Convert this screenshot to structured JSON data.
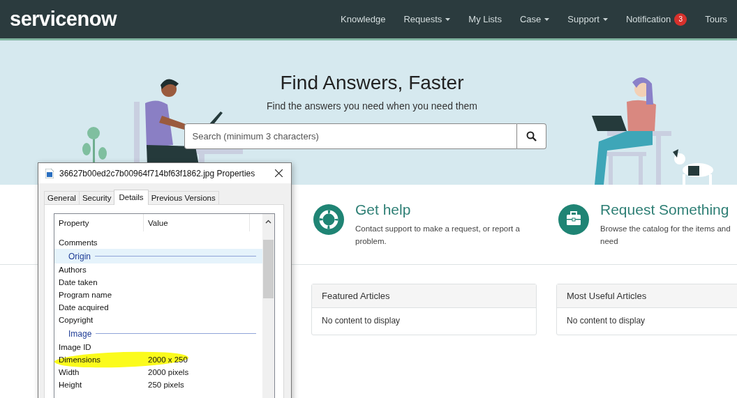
{
  "header": {
    "logo": "servicenow",
    "nav": [
      {
        "label": "Knowledge",
        "dropdown": false
      },
      {
        "label": "Requests",
        "dropdown": true
      },
      {
        "label": "My Lists",
        "dropdown": false
      },
      {
        "label": "Case",
        "dropdown": true
      },
      {
        "label": "Support",
        "dropdown": true
      },
      {
        "label": "Notification",
        "dropdown": false,
        "badge": "3"
      },
      {
        "label": "Tours",
        "dropdown": false
      }
    ]
  },
  "hero": {
    "title": "Find Answers, Faster",
    "subtitle": "Find the answers you need when you need them",
    "search": {
      "placeholder": "Search (minimum 3 characters)"
    }
  },
  "actions": [
    {
      "kind": "help",
      "title": "Get help",
      "description": [
        "Contact support to make a request, or report a",
        "problem."
      ]
    },
    {
      "kind": "request",
      "title": "Request Something",
      "description": [
        "Browse the catalog for the items and",
        "need"
      ]
    }
  ],
  "panels": [
    {
      "title": "Featured Articles",
      "body": "No content to display"
    },
    {
      "title": "Most Useful Articles",
      "body": "No content to display"
    }
  ],
  "dialog": {
    "title": "36627b00ed2c7b00964f714bf63f1862.jpg Properties",
    "tabs": [
      {
        "label": "General",
        "selected": false
      },
      {
        "label": "Security",
        "selected": false
      },
      {
        "label": "Details",
        "selected": true
      },
      {
        "label": "Previous Versions",
        "selected": false
      }
    ],
    "columns": [
      "Property",
      "Value"
    ],
    "rows": [
      {
        "kind": "row",
        "property": "Comments",
        "selected": false,
        "highlighted": false
      },
      {
        "kind": "group",
        "property": "Origin",
        "selected": true
      },
      {
        "kind": "row",
        "property": "Authors",
        "selected": false,
        "highlighted": false
      },
      {
        "kind": "row",
        "property": "Date taken",
        "selected": false,
        "highlighted": false
      },
      {
        "kind": "row",
        "property": "Program name",
        "selected": false,
        "highlighted": false
      },
      {
        "kind": "row",
        "property": "Date acquired",
        "selected": false,
        "highlighted": false
      },
      {
        "kind": "row",
        "property": "Copyright",
        "selected": false,
        "highlighted": false
      },
      {
        "kind": "group",
        "property": "Image",
        "selected": false
      },
      {
        "kind": "row",
        "property": "Image ID",
        "selected": false,
        "highlighted": false
      },
      {
        "kind": "row",
        "property": "Dimensions",
        "value": "2000 x 250",
        "selected": false,
        "highlighted": true
      },
      {
        "kind": "row",
        "property": "Width",
        "value": "2000 pixels",
        "selected": false,
        "highlighted": false
      },
      {
        "kind": "row",
        "property": "Height",
        "value": "250 pixels",
        "selected": false,
        "highlighted": false
      }
    ]
  }
}
